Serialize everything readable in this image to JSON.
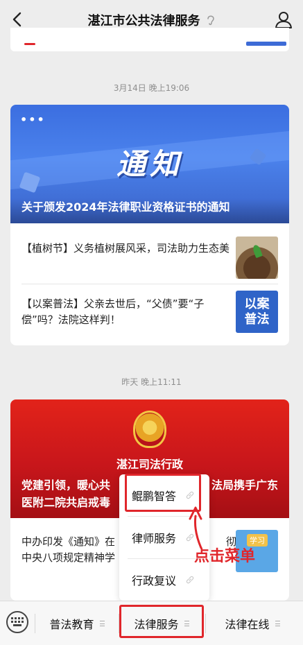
{
  "header": {
    "title": "湛江市公共法律服务"
  },
  "feed": {
    "ts1": "3月14日 晚上19:06",
    "ts2": "昨天 晚上11:11",
    "card1": {
      "cover_dots": "•••",
      "cover_title": "通知",
      "headline": "关于颁发2024年法律职业资格证书的通知",
      "items": [
        {
          "text": "【植树节】义务植树展风采，司法助力生态美"
        },
        {
          "text": "【以案普法】父亲去世后，“父债”要“子偿”吗？法院这样判！",
          "thumb_lines": [
            "以案",
            "普法"
          ]
        }
      ]
    },
    "card2": {
      "org": "湛江司法行政",
      "headline_line1": "党建引领，暖心共",
      "headline_line1_right": "法局携手广东",
      "headline_line2": "医附二院共启戒毒",
      "item_text_line1": "中办印发《通知》在",
      "item_text_line1_right": "彻",
      "item_text_line2": "中央八项规定精神学",
      "item_thumb_tag": "学习"
    }
  },
  "popup_menu": {
    "items": [
      {
        "label": "鲲鹏智答"
      },
      {
        "label": "律师服务"
      },
      {
        "label": "行政复议"
      }
    ]
  },
  "annotation": {
    "text": "点击菜单",
    "color": "#e0262b"
  },
  "bottom_menu": {
    "items": [
      {
        "label": "普法教育"
      },
      {
        "label": "法律服务"
      },
      {
        "label": "法律在线"
      }
    ]
  }
}
